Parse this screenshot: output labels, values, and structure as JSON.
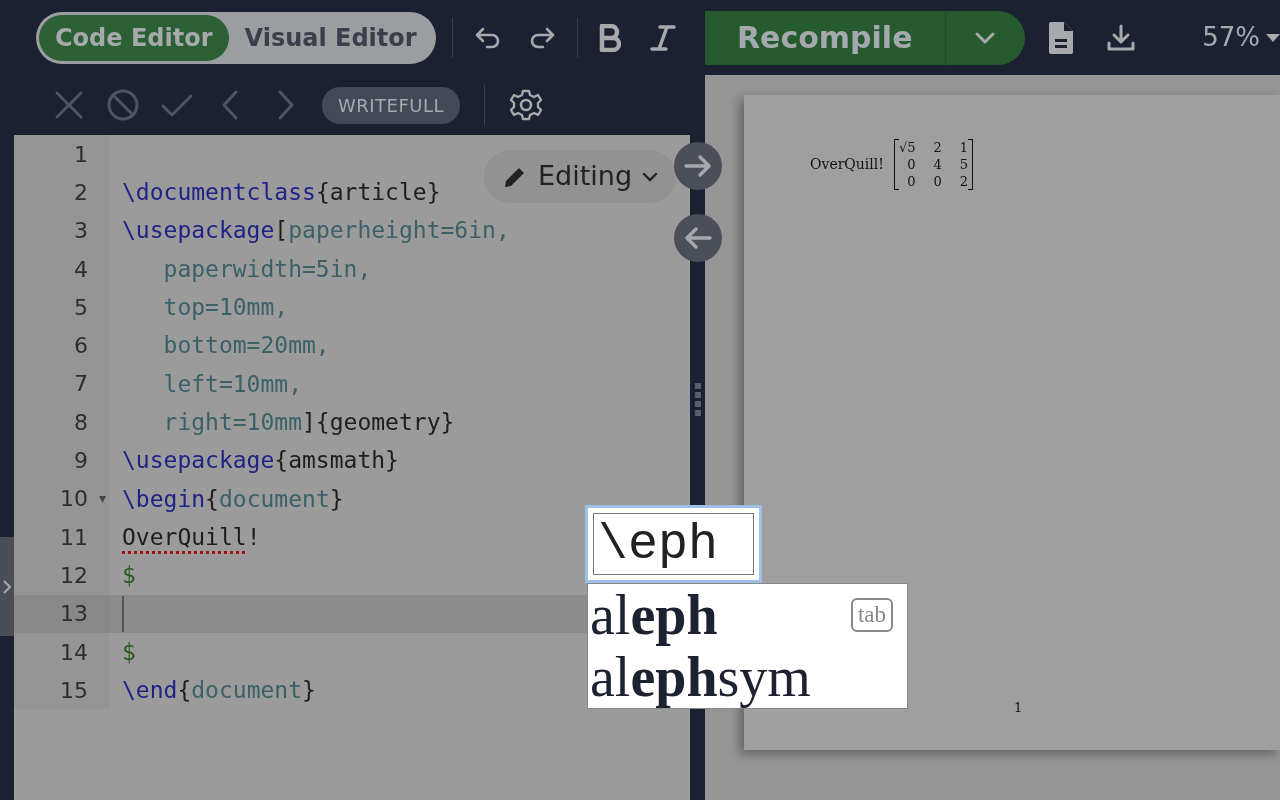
{
  "toolbar": {
    "editor_modes": [
      {
        "label": "Code Editor",
        "selected": true
      },
      {
        "label": "Visual Editor",
        "selected": false
      }
    ],
    "recompile": {
      "label": "Recompile"
    },
    "zoom": {
      "label": "57%"
    }
  },
  "writefull": {
    "label": "WRITEFULL"
  },
  "editing_mode": {
    "label": "Editing"
  },
  "code_lines": [
    {
      "number": "1",
      "active": false
    },
    {
      "number": "2",
      "active": false,
      "tokens": [
        {
          "kind": "command",
          "text": "\\documentclass"
        },
        {
          "kind": "text",
          "text": "{article}"
        }
      ]
    },
    {
      "number": "3",
      "active": false,
      "tokens": [
        {
          "kind": "command",
          "text": "\\usepackage"
        },
        {
          "kind": "text",
          "text": "["
        },
        {
          "kind": "option",
          "text": "paperheight=6in,"
        }
      ]
    },
    {
      "number": "4",
      "active": false,
      "tokens": [
        {
          "kind": "option",
          "text": "   paperwidth=5in,"
        }
      ]
    },
    {
      "number": "5",
      "active": false,
      "tokens": [
        {
          "kind": "option",
          "text": "   top=10mm,"
        }
      ]
    },
    {
      "number": "6",
      "active": false,
      "tokens": [
        {
          "kind": "option",
          "text": "   bottom=20mm,"
        }
      ]
    },
    {
      "number": "7",
      "active": false,
      "tokens": [
        {
          "kind": "option",
          "text": "   left=10mm,"
        }
      ]
    },
    {
      "number": "8",
      "active": false,
      "tokens": [
        {
          "kind": "option",
          "text": "   right=10mm"
        },
        {
          "kind": "text",
          "text": "]{geometry}"
        }
      ]
    },
    {
      "number": "9",
      "active": false,
      "tokens": [
        {
          "kind": "command",
          "text": "\\usepackage"
        },
        {
          "kind": "text",
          "text": "{amsmath}"
        }
      ]
    },
    {
      "number": "10",
      "active": false,
      "fold_marker": "▾",
      "tokens": [
        {
          "kind": "command",
          "text": "\\begin"
        },
        {
          "kind": "text",
          "text": "{"
        },
        {
          "kind": "option",
          "text": "document"
        },
        {
          "kind": "text",
          "text": "}"
        }
      ]
    },
    {
      "number": "11",
      "active": false,
      "tokens": [
        {
          "kind": "misspelled",
          "text": "OverQuill"
        },
        {
          "kind": "text",
          "text": "!"
        }
      ]
    },
    {
      "number": "12",
      "active": false,
      "tokens": [
        {
          "kind": "math",
          "text": "$"
        }
      ]
    },
    {
      "number": "13",
      "active": true
    },
    {
      "number": "14",
      "active": false,
      "tokens": [
        {
          "kind": "math",
          "text": "$"
        }
      ]
    },
    {
      "number": "15",
      "active": false,
      "tokens": [
        {
          "kind": "command",
          "text": "\\end"
        },
        {
          "kind": "text",
          "text": "{"
        },
        {
          "kind": "option",
          "text": "document"
        },
        {
          "kind": "text",
          "text": "}"
        }
      ]
    }
  ],
  "preview": {
    "text": "OverQuill!",
    "matrix": [
      [
        "√5",
        "2",
        "1"
      ],
      [
        "0",
        "4",
        "5"
      ],
      [
        "0",
        "0",
        "2"
      ]
    ],
    "page_number": "1"
  },
  "autocomplete": {
    "query": "\\eph",
    "suggestions": [
      {
        "label": "al**eph**",
        "shortcut": "tab"
      },
      {
        "label": "al**eph**sym"
      }
    ]
  }
}
